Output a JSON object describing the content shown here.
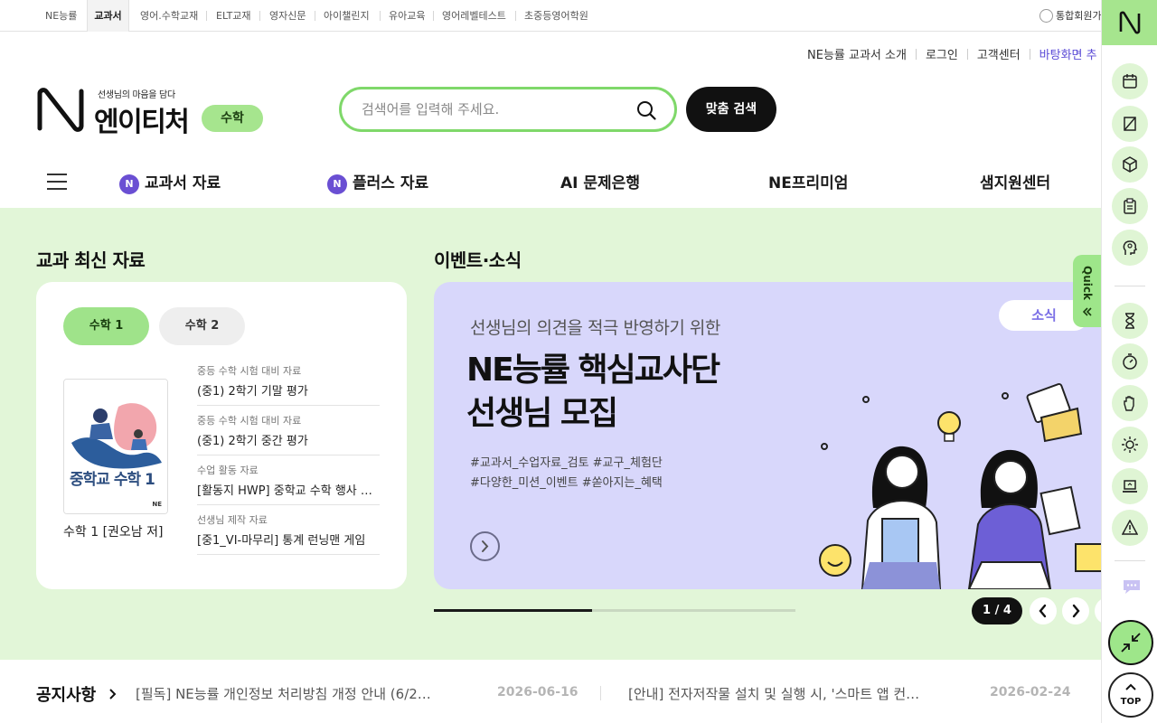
{
  "topbar": {
    "sites": [
      "NE능률",
      "교과서",
      "영어.수학교재",
      "ELT교재",
      "영자신문",
      "아이챌린지",
      "유아교육",
      "영어레벨테스트",
      "초중등영어학원"
    ],
    "active_index": 1,
    "member_link": "통합회원가"
  },
  "util": {
    "intro": "NE능률 교과서 소개",
    "login": "로그인",
    "support": "고객센터",
    "desktop": "바탕화면 추"
  },
  "logo": {
    "tagline": "선생님의 마음을 담다",
    "name": "엔이티처",
    "subject": "수학"
  },
  "search": {
    "placeholder": "검색어를 입력해 주세요.",
    "button_label": "맞춤 검색"
  },
  "gnb": {
    "menu": [
      "교과서 자료",
      "플러스 자료",
      "AI 문제은행",
      "NE프리미엄",
      "샘지원센터"
    ],
    "badge_letter": "N"
  },
  "latest": {
    "title": "교과 최신 자료",
    "tabs": [
      "수학 1",
      "수학 2"
    ],
    "book_cover_text": "중학교 수학 1",
    "book_cover_publisher": "NE",
    "book_title": "수학 1 [권오남 저]",
    "items": [
      {
        "category": "중등 수학 시험 대비 자료",
        "title": "(중1) 2학기 기말 평가"
      },
      {
        "category": "중등 수학 시험 대비 자료",
        "title": "(중1) 2학기 중간 평가"
      },
      {
        "category": "수업 활동 자료",
        "title": "[활동지 HWP] 중학교 수학 행사 …"
      },
      {
        "category": "선생님 제작 자료",
        "title": "[중1_VI-마무리] 통계 런닝맨 게임"
      }
    ]
  },
  "events": {
    "title": "이벤트·소식",
    "banner": {
      "subtitle": "선생님의 의견을 적극 반영하기 위한",
      "headline_1": "NE능률 핵심교사단",
      "headline_2": "선생님 모집",
      "tags_1": "#교과서_수업자료_검토 #교구_체험단",
      "tags_2": "#다양한_미션_이벤트 #쏟아지는_혜택",
      "badge": "소식"
    },
    "progress": 0.4375,
    "pager": "1 / 4"
  },
  "notice": {
    "label": "공지사항",
    "items": [
      {
        "text": "[필독] NE능률 개인정보 처리방침 개정 안내 (6/2…",
        "date": "2026-06-16"
      },
      {
        "text": "[안내] 전자저작물 설치 및 실행 시, '스마트 앱 컨트…",
        "date": "2026-02-24"
      }
    ]
  },
  "quick": {
    "label": "Quick"
  },
  "rail": {
    "icons": [
      "calendar-icon",
      "bookmark-icon",
      "box-icon",
      "clipboard-icon",
      "idea-head-icon",
      "hourglass-icon",
      "stopwatch-icon",
      "hand-icon",
      "sun-icon",
      "laptop-icon",
      "warning-icon",
      "chat-icon"
    ],
    "top_label": "TOP",
    "accent": "#a6e58e"
  },
  "colors": {
    "green_bg": "#e2f6d8",
    "green_accent": "#9ee68a",
    "search_border": "#7fd86a",
    "purple": "#6a4fd3",
    "banner_bg": "#d8d7fb"
  }
}
